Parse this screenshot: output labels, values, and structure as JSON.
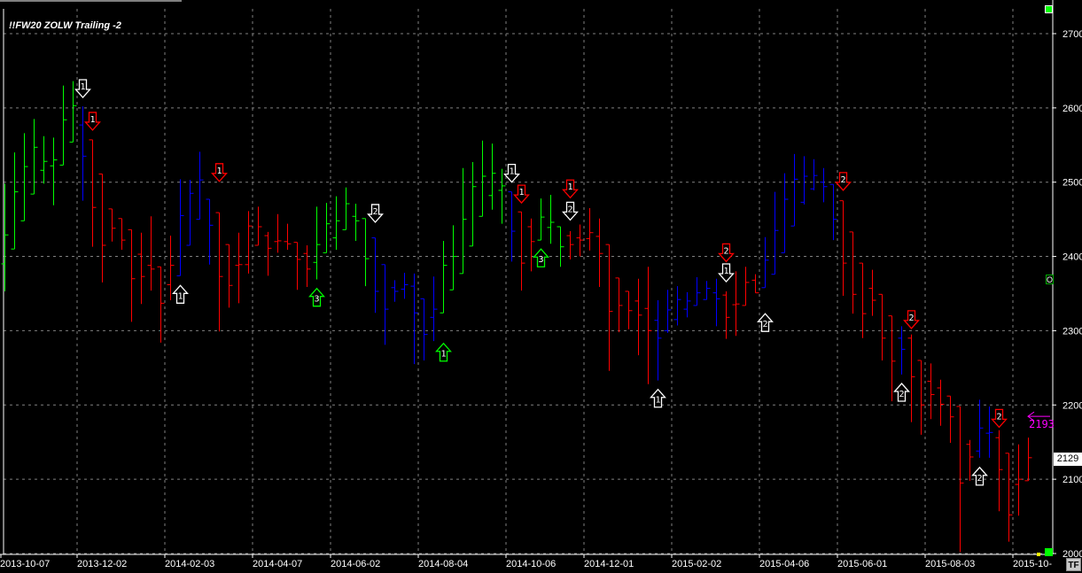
{
  "title": "!!FW20 ZOLW Trailing -2",
  "last_price_label": "2129",
  "alert": {
    "price_label": "2193",
    "color": "#ff00ff"
  },
  "tf_button": "TF",
  "scroll_marker": "O",
  "colors": {
    "g": "#00ff00",
    "b": "#0000ff",
    "r": "#ff0000",
    "w": "#ffffff",
    "grid": "#808080"
  },
  "chart_data": {
    "type": "ohlc",
    "title": "!!FW20 ZOLW Trailing -2",
    "ylim": [
      2000,
      2733
    ],
    "y_ticks": [
      2000,
      2100,
      2200,
      2300,
      2400,
      2500,
      2600,
      2700
    ],
    "grid": true,
    "x_ticks": [
      {
        "bar": 0,
        "label": "2013-10-07"
      },
      {
        "bar": 8,
        "label": "2013-12-02"
      },
      {
        "bar": 17,
        "label": "2014-02-03"
      },
      {
        "bar": 26,
        "label": "2014-04-07"
      },
      {
        "bar": 34,
        "label": "2014-06-02"
      },
      {
        "bar": 43,
        "label": "2014-08-04"
      },
      {
        "bar": 52,
        "label": "2014-10-06"
      },
      {
        "bar": 60,
        "label": "2014-12-01"
      },
      {
        "bar": 69,
        "label": "2015-02-02"
      },
      {
        "bar": 78,
        "label": "2015-04-06"
      },
      {
        "bar": 86,
        "label": "2015-06-01"
      },
      {
        "bar": 95,
        "label": "2015-08-03"
      },
      {
        "bar": 104,
        "label": "2015-10-"
      }
    ],
    "bars_columns": [
      "open",
      "high",
      "low",
      "close",
      "color"
    ],
    "bars": [
      [
        2390,
        2498,
        2353,
        2429,
        "g"
      ],
      [
        2410,
        2540,
        2410,
        2487,
        "g"
      ],
      [
        2448,
        2566,
        2448,
        2521,
        "g"
      ],
      [
        2484,
        2585,
        2484,
        2547,
        "g"
      ],
      [
        2516,
        2562,
        2498,
        2528,
        "g"
      ],
      [
        2522,
        2560,
        2469,
        2530,
        "g"
      ],
      [
        2523,
        2630,
        2523,
        2584,
        "g"
      ],
      [
        2554,
        2636,
        2554,
        2603,
        "g"
      ],
      [
        2577,
        2602,
        2475,
        2535,
        "b"
      ],
      [
        2557,
        2557,
        2413,
        2466,
        "r"
      ],
      [
        2511,
        2511,
        2365,
        2415,
        "r"
      ],
      [
        2464,
        2464,
        2420,
        2438,
        "r"
      ],
      [
        2451,
        2451,
        2409,
        2422,
        "r"
      ],
      [
        2436,
        2436,
        2312,
        2370,
        "r"
      ],
      [
        2403,
        2432,
        2336,
        2373,
        "r"
      ],
      [
        2388,
        2454,
        2354,
        2383,
        "r"
      ],
      [
        2386,
        2386,
        2284,
        2337,
        "r"
      ],
      [
        2362,
        2428,
        2341,
        2388,
        "r"
      ],
      [
        2374,
        2504,
        2374,
        2455,
        "b"
      ],
      [
        2415,
        2503,
        2415,
        2485,
        "b"
      ],
      [
        2450,
        2541,
        2450,
        2503,
        "b"
      ],
      [
        2477,
        2477,
        2389,
        2442,
        "b"
      ],
      [
        2459,
        2459,
        2299,
        2373,
        "r"
      ],
      [
        2416,
        2416,
        2331,
        2361,
        "r"
      ],
      [
        2388,
        2432,
        2337,
        2389,
        "r"
      ],
      [
        2389,
        2461,
        2377,
        2441,
        "r"
      ],
      [
        2415,
        2467,
        2415,
        2440,
        "r"
      ],
      [
        2428,
        2433,
        2374,
        2411,
        "r"
      ],
      [
        2420,
        2457,
        2405,
        2421,
        "r"
      ],
      [
        2420,
        2444,
        2409,
        2417,
        "r"
      ],
      [
        2419,
        2419,
        2355,
        2396,
        "r"
      ],
      [
        2404,
        2415,
        2359,
        2383,
        "r"
      ],
      [
        2392,
        2467,
        2369,
        2416,
        "g"
      ],
      [
        2405,
        2472,
        2405,
        2444,
        "g"
      ],
      [
        2425,
        2481,
        2409,
        2448,
        "g"
      ],
      [
        2436,
        2493,
        2436,
        2471,
        "g"
      ],
      [
        2454,
        2471,
        2421,
        2448,
        "g"
      ],
      [
        2451,
        2451,
        2360,
        2397,
        "g"
      ],
      [
        2425,
        2425,
        2324,
        2353,
        "b"
      ],
      [
        2389,
        2389,
        2281,
        2329,
        "b"
      ],
      [
        2358,
        2368,
        2339,
        2353,
        "b"
      ],
      [
        2356,
        2378,
        2343,
        2362,
        "b"
      ],
      [
        2360,
        2377,
        2255,
        2324,
        "b"
      ],
      [
        2343,
        2343,
        2260,
        2295,
        "b"
      ],
      [
        2318,
        2373,
        2286,
        2329,
        "b"
      ],
      [
        2324,
        2421,
        2324,
        2388,
        "g"
      ],
      [
        2355,
        2442,
        2355,
        2400,
        "g"
      ],
      [
        2377,
        2519,
        2377,
        2450,
        "g"
      ],
      [
        2414,
        2527,
        2414,
        2494,
        "g"
      ],
      [
        2454,
        2556,
        2454,
        2508,
        "g"
      ],
      [
        2482,
        2552,
        2463,
        2512,
        "g"
      ],
      [
        2489,
        2518,
        2444,
        2495,
        "g"
      ],
      [
        2487,
        2487,
        2393,
        2434,
        "b"
      ],
      [
        2460,
        2460,
        2354,
        2391,
        "r"
      ],
      [
        2440,
        2451,
        2380,
        2420,
        "r"
      ],
      [
        2422,
        2478,
        2422,
        2453,
        "g"
      ],
      [
        2439,
        2483,
        2417,
        2446,
        "g"
      ],
      [
        2440,
        2440,
        2386,
        2413,
        "g"
      ],
      [
        2428,
        2434,
        2396,
        2416,
        "r"
      ],
      [
        2425,
        2443,
        2400,
        2422,
        "r"
      ],
      [
        2424,
        2465,
        2408,
        2432,
        "r"
      ],
      [
        2427,
        2451,
        2359,
        2404,
        "r"
      ],
      [
        2416,
        2416,
        2246,
        2326,
        "r"
      ],
      [
        2371,
        2371,
        2298,
        2334,
        "r"
      ],
      [
        2353,
        2353,
        2302,
        2327,
        "r"
      ],
      [
        2340,
        2370,
        2267,
        2321,
        "r"
      ],
      [
        2330,
        2386,
        2228,
        2300,
        "r"
      ],
      [
        2314,
        2341,
        2233,
        2290,
        "b"
      ],
      [
        2300,
        2355,
        2297,
        2328,
        "b"
      ],
      [
        2315,
        2360,
        2307,
        2342,
        "b"
      ],
      [
        2329,
        2352,
        2318,
        2340,
        "b"
      ],
      [
        2334,
        2372,
        2334,
        2351,
        "b"
      ],
      [
        2342,
        2367,
        2342,
        2357,
        "b"
      ],
      [
        2351,
        2370,
        2306,
        2343,
        "b"
      ],
      [
        2348,
        2353,
        2289,
        2318,
        "r"
      ],
      [
        2335,
        2380,
        2293,
        2336,
        "r"
      ],
      [
        2334,
        2386,
        2334,
        2365,
        "r"
      ],
      [
        2368,
        2376,
        2351,
        2351,
        "r"
      ],
      [
        2358,
        2426,
        2358,
        2395,
        "b"
      ],
      [
        2376,
        2487,
        2376,
        2435,
        "b"
      ],
      [
        2405,
        2512,
        2405,
        2477,
        "b"
      ],
      [
        2441,
        2538,
        2441,
        2504,
        "b"
      ],
      [
        2473,
        2535,
        2470,
        2508,
        "b"
      ],
      [
        2491,
        2531,
        2489,
        2509,
        "b"
      ],
      [
        2500,
        2519,
        2473,
        2494,
        "b"
      ],
      [
        2497,
        2497,
        2422,
        2450,
        "b"
      ],
      [
        2475,
        2475,
        2347,
        2391,
        "r"
      ],
      [
        2433,
        2433,
        2323,
        2349,
        "r"
      ],
      [
        2391,
        2391,
        2290,
        2323,
        "r"
      ],
      [
        2357,
        2382,
        2320,
        2341,
        "r"
      ],
      [
        2349,
        2349,
        2260,
        2290,
        "r"
      ],
      [
        2320,
        2320,
        2205,
        2259,
        "r"
      ],
      [
        2290,
        2306,
        2241,
        2275,
        "b"
      ],
      [
        2290,
        2295,
        2177,
        2238,
        "r"
      ],
      [
        2260,
        2260,
        2160,
        2200,
        "r"
      ],
      [
        2232,
        2256,
        2181,
        2214,
        "r"
      ],
      [
        2223,
        2234,
        2172,
        2201,
        "r"
      ],
      [
        2212,
        2212,
        2149,
        2184,
        "r"
      ],
      [
        2198,
        2198,
        2002,
        2095,
        "r"
      ],
      [
        2147,
        2153,
        2098,
        2130,
        "r"
      ],
      [
        2138,
        2207,
        2129,
        2169,
        "b"
      ],
      [
        2162,
        2198,
        2129,
        2163,
        "b"
      ],
      [
        2156,
        2166,
        2057,
        2113,
        "r"
      ],
      [
        2135,
        2135,
        2016,
        2052,
        "r"
      ],
      [
        2093,
        2147,
        2051,
        2100,
        "r"
      ],
      [
        2098,
        2156,
        2098,
        2129,
        "r"
      ]
    ],
    "signals": [
      {
        "bar": 8,
        "price": 2626,
        "dir": "down",
        "color": "w",
        "label": "1"
      },
      {
        "bar": 9,
        "price": 2582,
        "dir": "down",
        "color": "r",
        "label": "1"
      },
      {
        "bar": 18,
        "price": 2349,
        "dir": "up",
        "color": "w",
        "label": "1"
      },
      {
        "bar": 22,
        "price": 2513,
        "dir": "down",
        "color": "r",
        "label": "1"
      },
      {
        "bar": 32,
        "price": 2345,
        "dir": "up",
        "color": "g",
        "label": "3"
      },
      {
        "bar": 38,
        "price": 2458,
        "dir": "down",
        "color": "w",
        "label": "2"
      },
      {
        "bar": 45,
        "price": 2271,
        "dir": "up",
        "color": "g",
        "label": "1"
      },
      {
        "bar": 52,
        "price": 2512,
        "dir": "down",
        "color": "w",
        "label": "1"
      },
      {
        "bar": 53,
        "price": 2484,
        "dir": "down",
        "color": "r",
        "label": "1"
      },
      {
        "bar": 55,
        "price": 2398,
        "dir": "up",
        "color": "g",
        "label": "3"
      },
      {
        "bar": 58,
        "price": 2491,
        "dir": "down",
        "color": "r",
        "label": "1"
      },
      {
        "bar": 58,
        "price": 2461,
        "dir": "down",
        "color": "w",
        "label": "2"
      },
      {
        "bar": 67,
        "price": 2209,
        "dir": "up",
        "color": "w",
        "label": "1"
      },
      {
        "bar": 74,
        "price": 2405,
        "dir": "down",
        "color": "r",
        "label": "2"
      },
      {
        "bar": 74,
        "price": 2378,
        "dir": "down",
        "color": "w",
        "label": "1"
      },
      {
        "bar": 78,
        "price": 2311,
        "dir": "up",
        "color": "w",
        "label": "2"
      },
      {
        "bar": 86,
        "price": 2501,
        "dir": "down",
        "color": "r",
        "label": "2"
      },
      {
        "bar": 92,
        "price": 2217,
        "dir": "up",
        "color": "w",
        "label": "2"
      },
      {
        "bar": 93,
        "price": 2315,
        "dir": "down",
        "color": "r",
        "label": "2"
      },
      {
        "bar": 100,
        "price": 2104,
        "dir": "up",
        "color": "w",
        "label": "2"
      },
      {
        "bar": 102,
        "price": 2182,
        "dir": "down",
        "color": "r",
        "label": "2"
      }
    ],
    "alert_price": 2193,
    "last_price": 2129
  }
}
